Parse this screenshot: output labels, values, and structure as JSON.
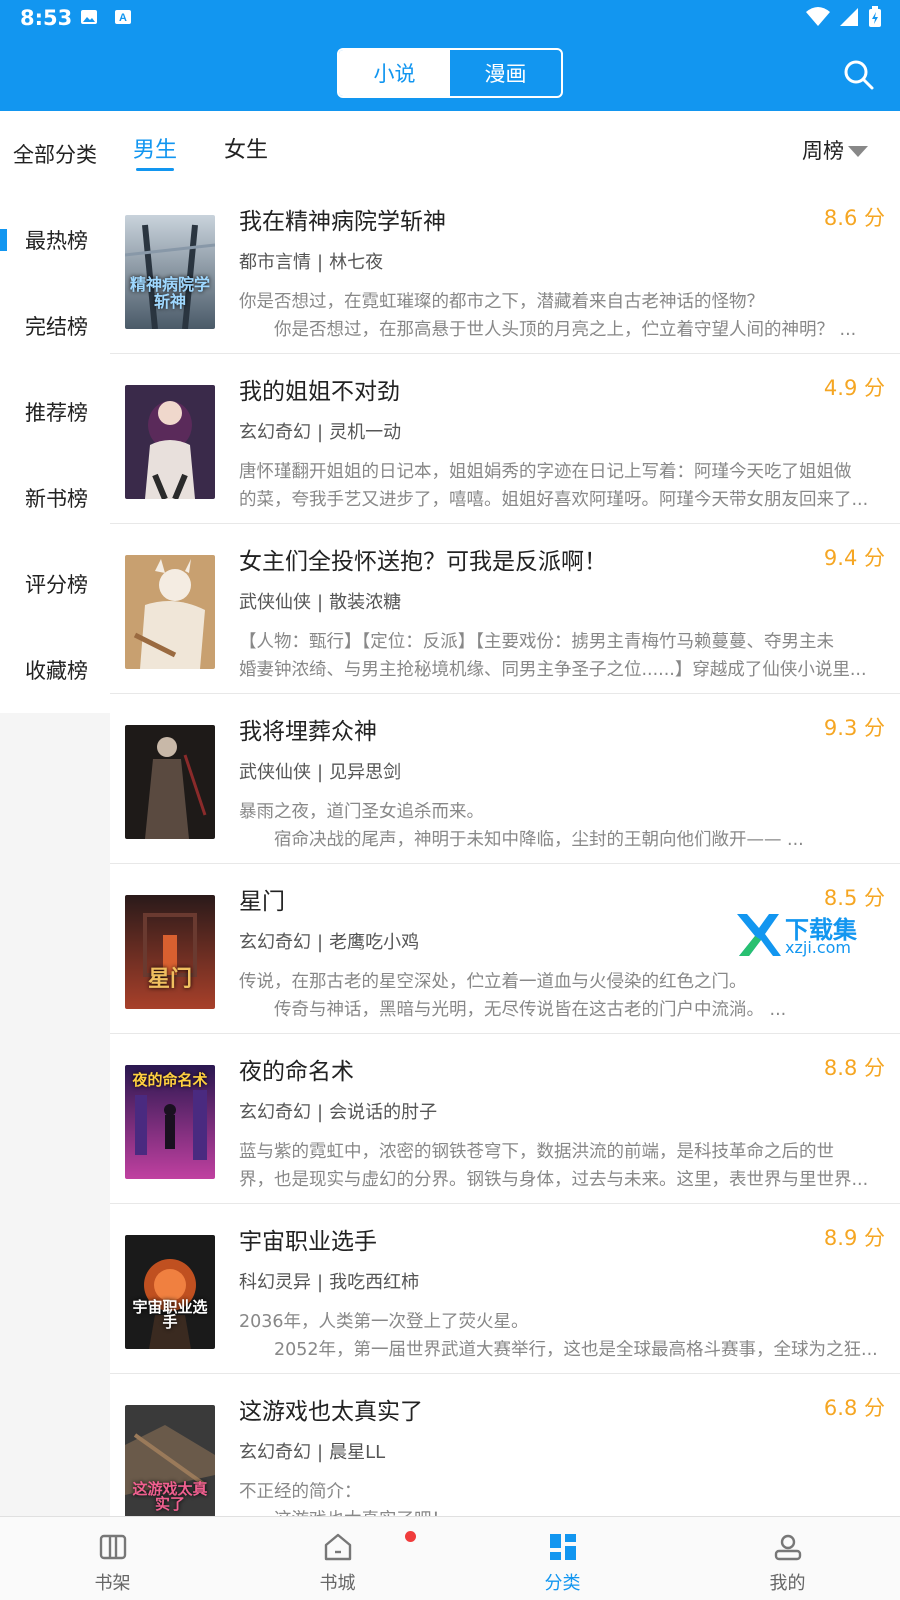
{
  "status_bar": {
    "time": "8:53"
  },
  "header": {
    "tabs": [
      {
        "label": "小说",
        "active": true
      },
      {
        "label": "漫画",
        "active": false
      }
    ],
    "accent": "#1296f0"
  },
  "sidebar": {
    "title": "全部分类",
    "items": [
      {
        "label": "最热榜",
        "active": true
      },
      {
        "label": "完结榜",
        "active": false
      },
      {
        "label": "推荐榜",
        "active": false
      },
      {
        "label": "新书榜",
        "active": false
      },
      {
        "label": "评分榜",
        "active": false
      },
      {
        "label": "收藏榜",
        "active": false
      }
    ]
  },
  "gender_tabs": [
    {
      "label": "男生",
      "active": true
    },
    {
      "label": "女生",
      "active": false
    }
  ],
  "rank_select": "周榜",
  "books": [
    {
      "title": "我在精神病院学斩神",
      "score": "8.6 分",
      "category": "都市言情",
      "author": "林七夜",
      "desc1": "你是否想过，在霓虹璀璨的都市之下，潜藏着来自古老神话的怪物？",
      "desc2": "　　你是否想过，在那高悬于世人头顶的月亮之上，伫立着守望人间的神明？ ...",
      "cover_colors": [
        "#5a6b7a",
        "#c9d3dc"
      ],
      "cover_text": "精神病院学斩神"
    },
    {
      "title": "我的姐姐不对劲",
      "score": "4.9 分",
      "category": "玄幻奇幻",
      "author": "灵机一动",
      "desc1": "唐怀瑾翻开姐姐的日记本，姐姐娟秀的字迹在日记上写着：阿瑾今天吃了姐姐做",
      "desc2": "的菜，夸我手艺又进步了，嘻嘻。姐姐好喜欢阿瑾呀。阿瑾今天带女朋友回来了...",
      "cover_colors": [
        "#3a2a4a",
        "#e8d8d0"
      ],
      "cover_text": ""
    },
    {
      "title": "女主们全投怀送抱？可我是反派啊！",
      "score": "9.4 分",
      "category": "武侠仙侠",
      "author": "散装浓糖",
      "desc1": "【人物：甄行】【定位：反派】【主要戏份：掳男主青梅竹马赖蔓蔓、夺男主未",
      "desc2": "婚妻钟浓绮、与男主抢秘境机缘、同男主争圣子之位......】穿越成了仙侠小说里...",
      "cover_colors": [
        "#c8a070",
        "#f0e6d8"
      ],
      "cover_text": ""
    },
    {
      "title": "我将埋葬众神",
      "score": "9.3 分",
      "category": "武侠仙侠",
      "author": "见异思剑",
      "desc1": "暴雨之夜，道门圣女追杀而来。",
      "desc2": "　　宿命决战的尾声，神明于未知中降临，尘封的王朝向他们敞开—— ...",
      "cover_colors": [
        "#1e1a18",
        "#6a4a38"
      ],
      "cover_text": ""
    },
    {
      "title": "星门",
      "score": "8.5 分",
      "category": "玄幻奇幻",
      "author": "老鹰吃小鸡",
      "desc1": "传说，在那古老的星空深处，伫立着一道血与火侵染的红色之门。",
      "desc2": "　　传奇与神话，黑暗与光明，无尽传说皆在这古老的门户中流淌。 ...",
      "cover_colors": [
        "#2a1a1a",
        "#a8402a"
      ],
      "cover_text": "星门"
    },
    {
      "title": "夜的命名术",
      "score": "8.8 分",
      "category": "玄幻奇幻",
      "author": "会说话的肘子",
      "desc1": "蓝与紫的霓虹中，浓密的钢铁苍穹下，数据洪流的前端，是科技革命之后的世",
      "desc2": "界，也是现实与虚幻的分界。钢铁与身体，过去与未来。这里，表世界与里世界...",
      "cover_colors": [
        "#2a1850",
        "#c040a0"
      ],
      "cover_text": "夜的命名术"
    },
    {
      "title": "宇宙职业选手",
      "score": "8.9 分",
      "category": "科幻灵异",
      "author": "我吃西红柿",
      "desc1": "2036年，人类第一次登上了荧火星。",
      "desc2": "　　2052年，第一届世界武道大赛举行，这也是全球最高格斗赛事，全球为之狂...",
      "cover_colors": [
        "#1a1a1a",
        "#c05020"
      ],
      "cover_text": "宇宙职业选手"
    },
    {
      "title": "这游戏也太真实了",
      "score": "6.8 分",
      "category": "玄幻奇幻",
      "author": "晨星LL",
      "desc1": "不正经的简介：",
      "desc2": "　　这游戏也太真实了吧！",
      "cover_colors": [
        "#3a3a3a",
        "#9a7a5a"
      ],
      "cover_text": "这游戏太真实了"
    }
  ],
  "watermark": {
    "line1": "下载集",
    "line2": "xzji.com"
  },
  "bottom_nav": [
    {
      "label": "书架",
      "icon": "bookshelf-icon",
      "active": false
    },
    {
      "label": "书城",
      "icon": "home-icon",
      "active": false
    },
    {
      "label": "分类",
      "icon": "category-icon",
      "active": true
    },
    {
      "label": "我的",
      "icon": "profile-icon",
      "active": false
    }
  ]
}
